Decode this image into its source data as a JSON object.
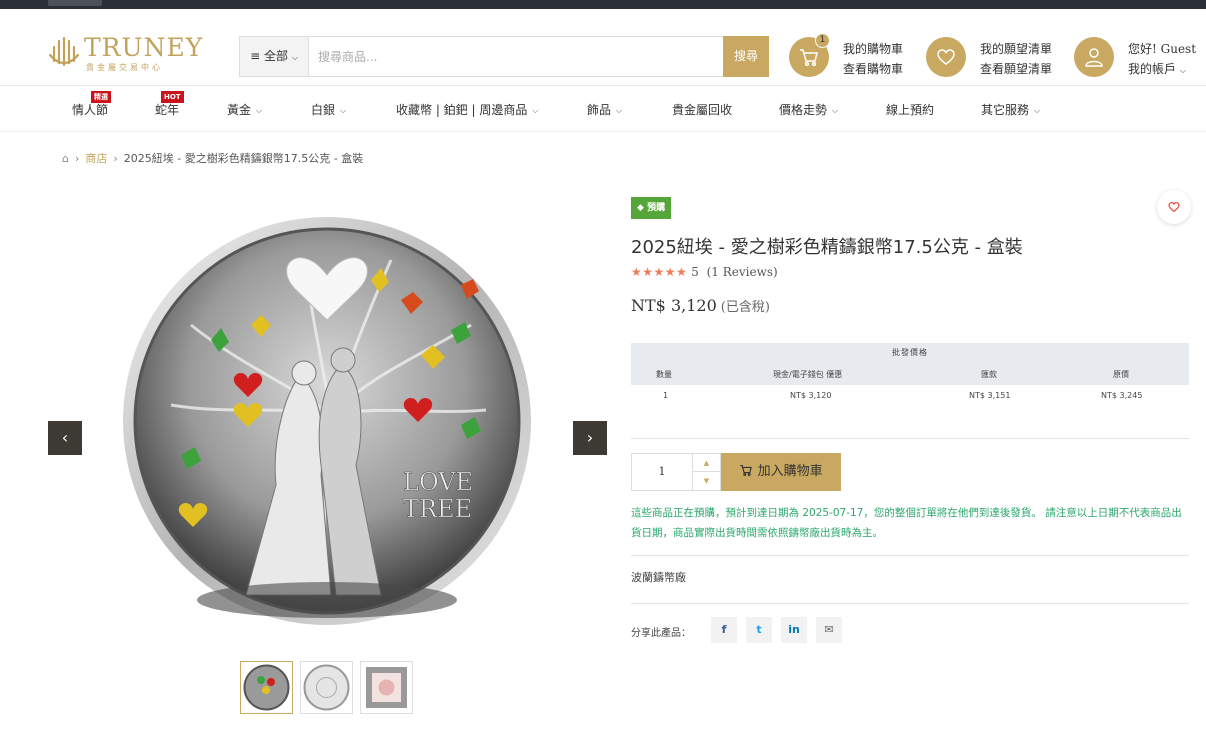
{
  "header": {
    "logo_text": "TRUNEY",
    "logo_tagline": "貴金屬交易中心",
    "search_category": "全部",
    "search_placeholder": "搜尋商品...",
    "search_button": "搜尋",
    "cart": {
      "count": "1",
      "line1": "我的購物車",
      "line2": "查看購物車"
    },
    "wishlist": {
      "line1": "我的願望清單",
      "line2": "查看願望清單"
    },
    "account": {
      "line1": "您好! Guest",
      "line2": "我的帳戶"
    }
  },
  "nav": {
    "items": [
      {
        "label": "情人節",
        "tag": "精選"
      },
      {
        "label": "蛇年",
        "tag": "HOT"
      },
      {
        "label": "黃金"
      },
      {
        "label": "白銀"
      },
      {
        "label": "收藏幣 | 鉑鈀 | 周邊商品"
      },
      {
        "label": "飾品"
      },
      {
        "label": "貴金屬回收"
      },
      {
        "label": "價格走勢"
      },
      {
        "label": "線上預約"
      },
      {
        "label": "其它服務"
      }
    ]
  },
  "breadcrumb": {
    "shop": "商店",
    "current": "2025紐埃 - 愛之樹彩色精鑄銀幣17.5公克 - 盒裝"
  },
  "product": {
    "badge": "預購",
    "title": "2025紐埃 - 愛之樹彩色精鑄銀幣17.5公克 - 盒裝",
    "rating_value": "5",
    "reviews": "(1 Reviews)",
    "price": "NT$ 3,120",
    "tax_note": "(已含稅)",
    "coin_text_1": "LOVE",
    "coin_text_2": "TREE"
  },
  "price_table": {
    "caption": "批發價格",
    "headers": [
      "數量",
      "現金/電子錢包 優惠",
      "匯款",
      "原價"
    ],
    "row": [
      "1",
      "NT$ 3,120",
      "NT$ 3,151",
      "NT$ 3,245"
    ]
  },
  "purchase": {
    "quantity": "1",
    "add_to_cart": "加入購物車",
    "notice": "這些商品正在預購，預計到達日期為 2025-07-17，您的整個訂單將在他們到達後發貨。 請注意以上日期不代表商品出貨日期，商品實際出貨時間需依照鑄幣廠出貨時為主。",
    "mint": "波蘭鑄幣廠",
    "share_label": "分享此產品："
  },
  "colors": {
    "gold": "#c9a962",
    "green_badge": "#55a539",
    "notice_green": "#2ba86d",
    "star": "#ef7b5d"
  }
}
